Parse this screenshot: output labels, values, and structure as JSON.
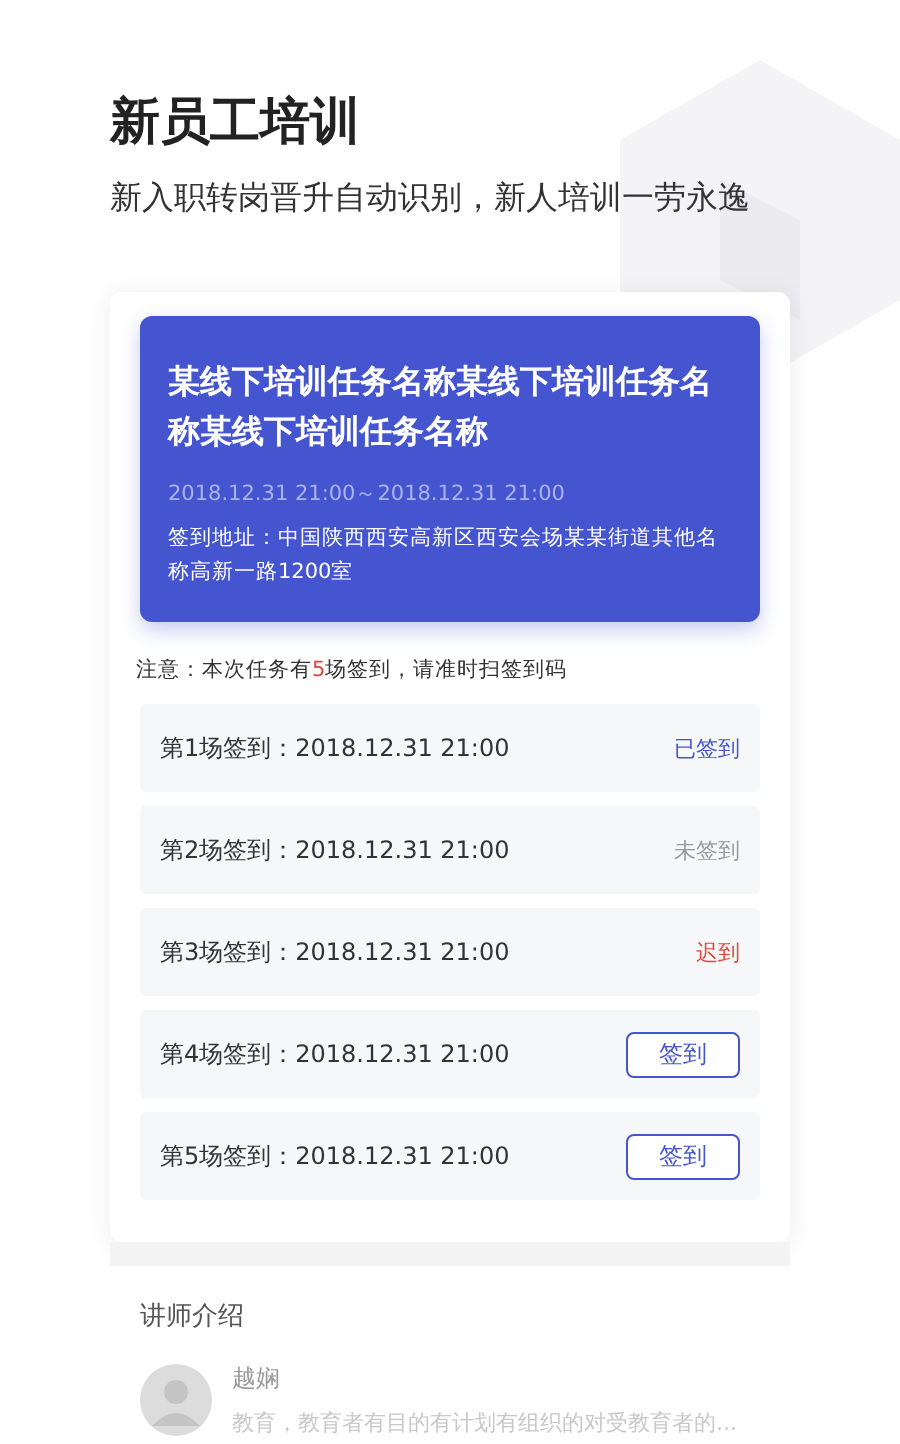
{
  "header": {
    "title": "新员工培训",
    "subtitle": "新入职转岗晋升自动识别，新人培训一劳永逸"
  },
  "task": {
    "title": "某线下培训任务名称某线下培训任务名称某线下培训任务名称",
    "time": "2018.12.31  21:00～2018.12.31  21:00",
    "address": "签到地址：中国陕西西安高新区西安会场某某街道其他名称高新一路1200室"
  },
  "notice": "注意：本次任务有**5**场签到，请准时扫签到码",
  "sessions": [
    {
      "label": "第1场签到：2018.12.31  21:00",
      "kind": "signed",
      "status": "已签到"
    },
    {
      "label": "第2场签到：2018.12.31  21:00",
      "kind": "unsigned",
      "status": "未签到"
    },
    {
      "label": "第3场签到：2018.12.31  21:00",
      "kind": "late",
      "status": "迟到"
    },
    {
      "label": "第4场签到：2018.12.31  21:00",
      "kind": "button",
      "status": "签到"
    },
    {
      "label": "第5场签到：2018.12.31  21:00",
      "kind": "button",
      "status": "签到"
    }
  ],
  "teacher_section": {
    "heading": "讲师介绍",
    "name": "越娴",
    "bio": "教育，教育者有目的有计划有组织的对受教育者的..."
  }
}
